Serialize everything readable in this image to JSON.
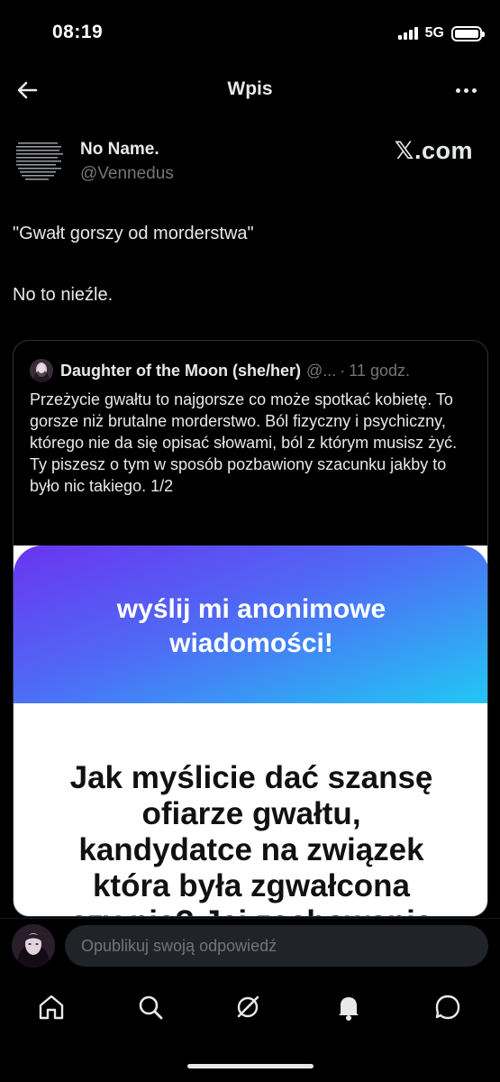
{
  "status_bar": {
    "time": "08:19",
    "network": "5G",
    "battery_level": 1.0
  },
  "topbar": {
    "title": "Wpis",
    "back_icon": "arrow-left-icon",
    "more_icon": "more-horizontal-icon"
  },
  "author": {
    "name": "No Name.",
    "handle": "@Vennedus",
    "badge": "𝕏.com"
  },
  "tweet": {
    "lines": [
      "\"Gwałt gorszy od morderstwa\"",
      "No to nieźle."
    ]
  },
  "quote": {
    "name": "Daughter of the Moon (she/her)",
    "handle": "@...",
    "separator": "·",
    "time": "11 godz.",
    "body": [
      "Przeżycie gwałtu to najgorsze co może spotkać kobietę. To gorsze niż brutalne morderstwo. Ból fizyczny i psychiczny, którego nie da się opisać słowami, ból z którym musisz żyć.",
      "Ty piszesz o tym w sposób pozbawiony szacunku jakby to było nic takiego. 1/2"
    ],
    "image": {
      "banner_lines": [
        "wyślij mi anonimowe",
        "wiadomości!"
      ],
      "text_lines": [
        "Jak myślicie dać szansę",
        "ofiarze gwałtu,",
        "kandydatce na związek",
        "która była zgwałcona",
        "czy nie? Jej zachowania"
      ]
    }
  },
  "reply": {
    "placeholder": "Opublikuj swoją odpowiedź"
  },
  "nav": {
    "items": [
      "home-icon",
      "search-icon",
      "grok-icon",
      "notifications-icon",
      "messages-icon"
    ]
  }
}
